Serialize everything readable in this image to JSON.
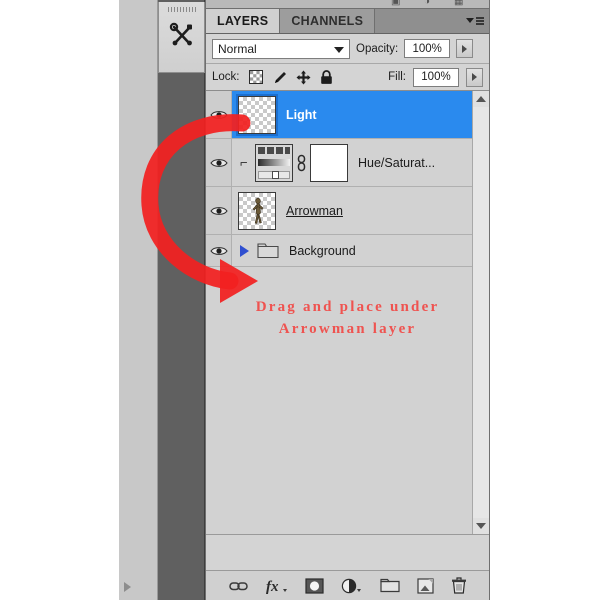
{
  "app": {
    "panel_title": "LAYERS",
    "left_dock": {
      "tools_icon": "tools-wrench-screwdriver-icon",
      "collapse_icon": "expand-right-triangle-icon"
    }
  },
  "tabs": [
    {
      "label": "LAYERS",
      "active": true
    },
    {
      "label": "CHANNELS",
      "active": false
    }
  ],
  "panel_menu": {
    "icon": "panel-menu-icon"
  },
  "blend": {
    "mode": "Normal",
    "opacity_label": "Opacity:",
    "opacity_value": "100%",
    "fill_label": "Fill:",
    "fill_value": "100%"
  },
  "lock": {
    "label": "Lock:",
    "items": [
      {
        "name": "lock-transparent-pixels-icon",
        "title": "Lock transparent pixels"
      },
      {
        "name": "lock-image-pixels-icon",
        "title": "Lock image pixels"
      },
      {
        "name": "lock-position-icon",
        "title": "Lock position"
      },
      {
        "name": "lock-all-icon",
        "title": "Lock all"
      }
    ]
  },
  "layers": [
    {
      "name": "Light",
      "selected": true,
      "visible": true,
      "type": "pixel",
      "underline": false
    },
    {
      "name": "Hue/Saturat...",
      "selected": false,
      "visible": true,
      "type": "adjustment",
      "clipped": true,
      "underline": false
    },
    {
      "name": "Arrowman",
      "selected": false,
      "visible": true,
      "type": "pixel",
      "underline": true
    },
    {
      "name": "Background",
      "selected": false,
      "visible": true,
      "type": "group",
      "underline": false
    }
  ],
  "annotation": {
    "line1": "Drag and place under",
    "line2": "Arrowman layer",
    "color": "#ef5350",
    "arrow": "red-curved-drag-arrow"
  },
  "scrollbar": {
    "up_icon": "scroll-up-arrow-icon",
    "down_icon": "scroll-down-arrow-icon"
  },
  "bottom_toolbar": [
    {
      "name": "link-layers-button",
      "label": "link-chain-icon"
    },
    {
      "name": "layer-style-button",
      "label": "fx-icon"
    },
    {
      "name": "add-layer-mask-button",
      "label": "mask-circle-icon"
    },
    {
      "name": "new-adjustment-layer-button",
      "label": "half-filled-circle-icon"
    },
    {
      "name": "new-group-button",
      "label": "folder-icon"
    },
    {
      "name": "new-layer-button",
      "label": "new-layer-icon"
    },
    {
      "name": "delete-layer-button",
      "label": "trash-icon"
    }
  ],
  "colors": {
    "selection_blue": "#2a8aee",
    "panel_bg": "#d4d4d4",
    "tools_column": "#606060",
    "annotation_red": "#ef5350"
  }
}
